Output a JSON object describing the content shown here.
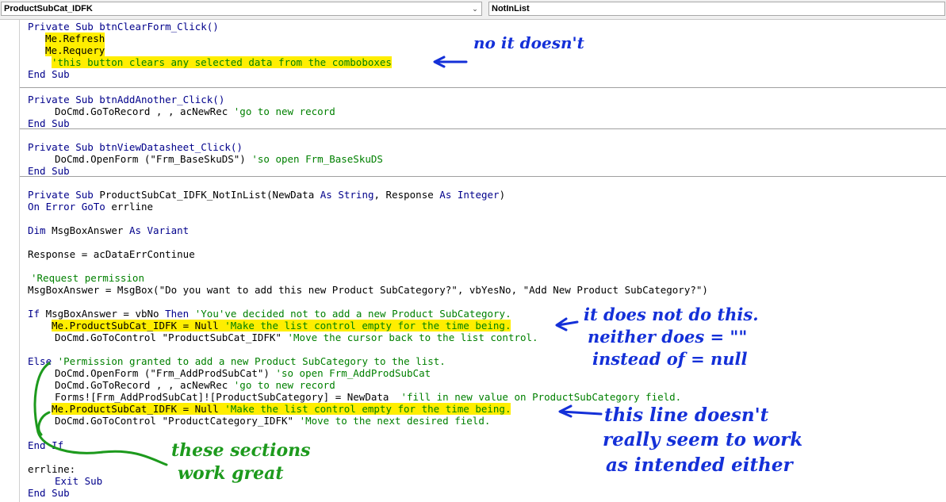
{
  "header": {
    "object_dropdown": "ProductSubCat_IDFK",
    "procedure_dropdown": "NotInList"
  },
  "code": {
    "l01": "Private Sub btnClearForm_Click()",
    "l02": "Me.Refresh",
    "l03": "Me.Requery",
    "l04": "'this button clears any selected data from the comboboxes",
    "l05": "End Sub",
    "l06": "Private Sub btnAddAnother_Click()",
    "l07_code": "DoCmd.GoToRecord , , acNewRec ",
    "l07_comment": "'go to new record",
    "l08": "End Sub",
    "l09": "Private Sub btnViewDatasheet_Click()",
    "l10_code": "DoCmd.OpenForm (\"Frm_BaseSkuDS\") ",
    "l10_comment": "'so open Frm_BaseSkuDS",
    "l11": "End Sub",
    "l12_a": "Private Sub ",
    "l12_b": "ProductSubCat_IDFK_NotInList(NewData ",
    "l12_c": "As String",
    "l12_d": ", Response ",
    "l12_e": "As Integer",
    "l12_f": ")",
    "l13_a": "On Error GoTo",
    "l13_b": " errline",
    "l14_a": "Dim",
    "l14_b": " MsgBoxAnswer ",
    "l14_c": "As Variant",
    "l15": "Response = acDataErrContinue",
    "l16": "'Request permission",
    "l17": "MsgBoxAnswer = MsgBox(\"Do you want to add this new Product SubCategory?\", vbYesNo, \"Add New Product SubCategory?\")",
    "l18_a": "If",
    "l18_b": " MsgBoxAnswer = vbNo ",
    "l18_c": "Then",
    "l18_d": " 'You've decided not to add a new Product SubCategory.",
    "l19_code": "Me.ProductSubCat_IDFK = Null ",
    "l19_comment": "'Make the list control empty for the time being.",
    "l20_code": "DoCmd.GoToControl \"ProductSubCat_IDFK\" ",
    "l20_comment": "'Move the cursor back to the list control.",
    "l21_a": "Else",
    "l21_b": " 'Permission granted to add a new Product SubCategory to the list.",
    "l22_code": "DoCmd.OpenForm (\"Frm_AddProdSubCat\") ",
    "l22_comment": "'so open Frm_AddProdSubCat",
    "l23_code": "DoCmd.GoToRecord , , acNewRec ",
    "l23_comment": "'go to new record",
    "l24_code": "Forms![Frm_AddProdSubCat]![ProductSubCategory] = NewData  ",
    "l24_comment": "'fill in new value on ProductSubCategory field.",
    "l25_code": "Me.ProductSubCat_IDFK = Null ",
    "l25_comment": "'Make the list control empty for the time being.",
    "l26_code": "DoCmd.GoToControl \"ProductCategory_IDFK\" ",
    "l26_comment": "'Move to the next desired field.",
    "l27": "End If",
    "l28": "errline:",
    "l29": "Exit Sub",
    "l30": "End Sub"
  },
  "annotations": {
    "a1": "no it doesn't",
    "a2_1": "it does not do this.",
    "a2_2": "neither does = \"\"",
    "a2_3": "instead of = null",
    "a3_1": "this line doesn't",
    "a3_2": "really seem to work",
    "a3_3": "as intended either",
    "a4_1": "these sections",
    "a4_2": "work great"
  },
  "colors": {
    "keyword": "#00008b",
    "comment": "#008000",
    "highlight": "#ffee00",
    "blue_ink": "#1430d8",
    "green_ink": "#1d9a1d"
  }
}
